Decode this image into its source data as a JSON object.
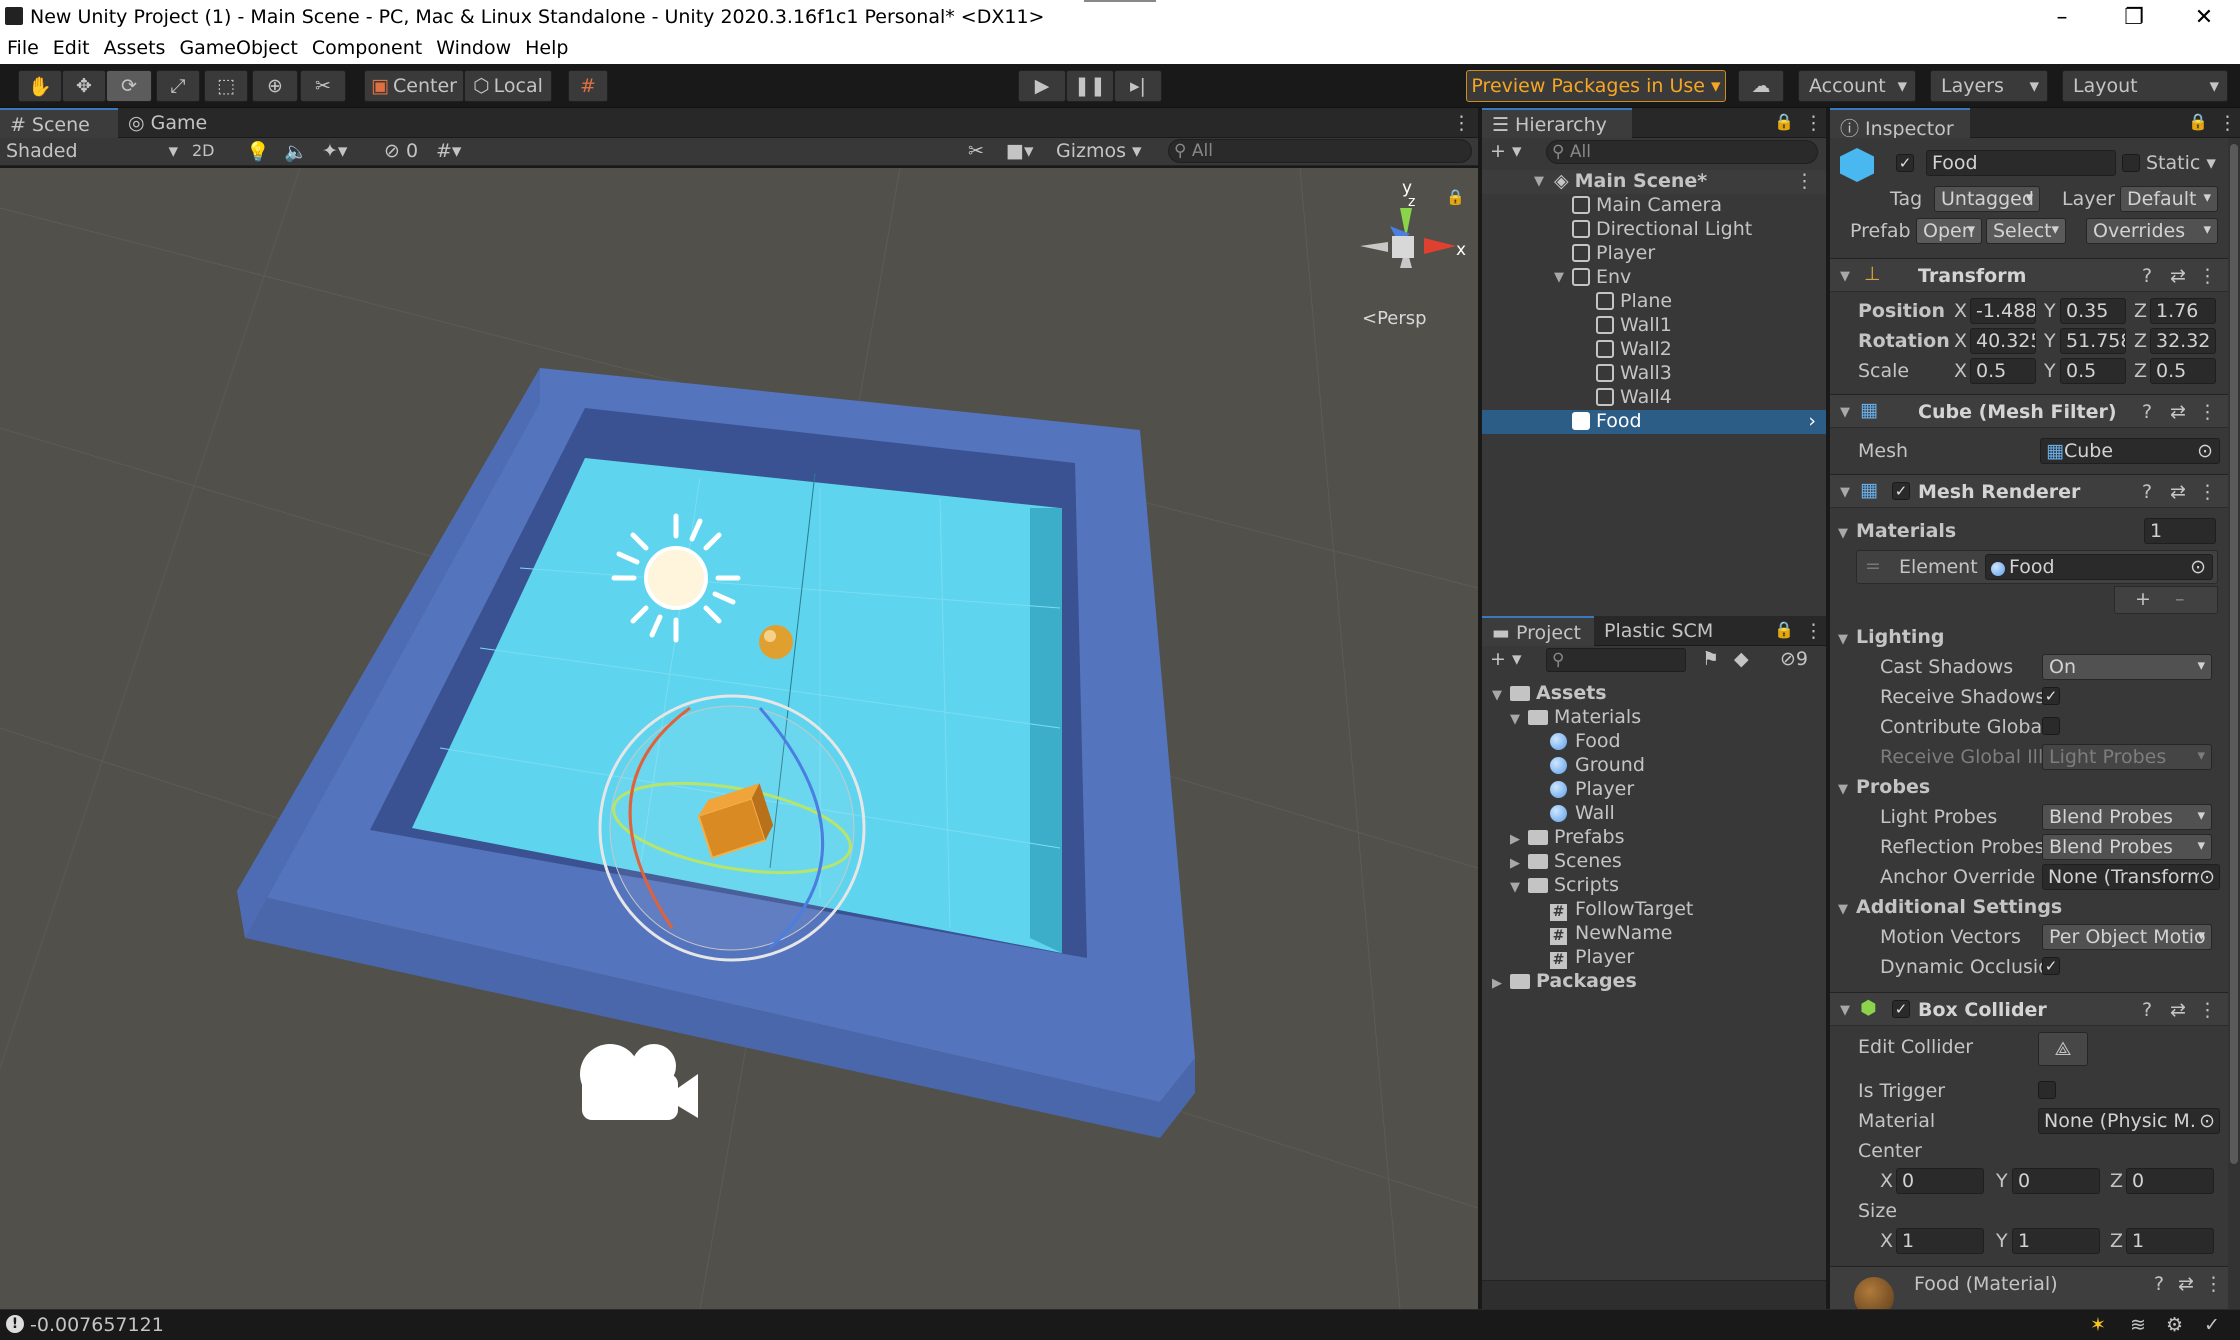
{
  "window": {
    "title": "New Unity Project (1) - Main Scene - PC, Mac & Linux Standalone - Unity 2020.3.16f1c1 Personal* <DX11>"
  },
  "menu": [
    "File",
    "Edit",
    "Assets",
    "GameObject",
    "Component",
    "Window",
    "Help"
  ],
  "toolbar": {
    "center_label": "Center",
    "local_label": "Local",
    "preview_packages": "Preview Packages in Use",
    "account": "Account",
    "layers": "Layers",
    "layout": "Layout"
  },
  "scene_view": {
    "tabs": [
      "Scene",
      "Game"
    ],
    "shading": "Shaded",
    "mode_2d": "2D",
    "hidden_count": "0",
    "gizmos": "Gizmos",
    "search_placeholder": "All",
    "persp_label": "Persp",
    "gizmo_axis_y": "y",
    "gizmo_axis_z": "z",
    "gizmo_axis_x": "x"
  },
  "hierarchy": {
    "title": "Hierarchy",
    "search_placeholder": "All",
    "scene": "Main Scene*",
    "items": [
      "Main Camera",
      "Directional Light",
      "Player",
      "Env",
      "Plane",
      "Wall1",
      "Wall2",
      "Wall3",
      "Wall4",
      "Food"
    ],
    "selected": "Food"
  },
  "project": {
    "tabs": [
      "Project",
      "Plastic SCM"
    ],
    "hidden_count": "9",
    "tree": {
      "assets": "Assets",
      "materials": "Materials",
      "mat_items": [
        "Food",
        "Ground",
        "Player",
        "Wall"
      ],
      "prefabs": "Prefabs",
      "scenes": "Scenes",
      "scripts": "Scripts",
      "script_items": [
        "FollowTarget",
        "NewName",
        "Player"
      ],
      "packages": "Packages"
    }
  },
  "inspector": {
    "title": "Inspector",
    "object_name": "Food",
    "static_label": "Static",
    "tag_label": "Tag",
    "tag_value": "Untagged",
    "layer_label": "Layer",
    "layer_value": "Default",
    "prefab_label": "Prefab",
    "open": "Open",
    "select": "Select",
    "overrides": "Overrides",
    "transform": {
      "title": "Transform",
      "position_label": "Position",
      "rotation_label": "Rotation",
      "scale_label": "Scale",
      "position": {
        "x": "-1.488",
        "y": "0.35",
        "z": "1.76"
      },
      "rotation": {
        "x": "40.325",
        "y": "51.758",
        "z": "32.32"
      },
      "scale": {
        "x": "0.5",
        "y": "0.5",
        "z": "0.5"
      }
    },
    "mesh_filter": {
      "title": "Cube (Mesh Filter)",
      "mesh_label": "Mesh",
      "mesh_value": "Cube"
    },
    "mesh_renderer": {
      "title": "Mesh Renderer",
      "materials_label": "Materials",
      "materials_count": "1",
      "element_label": "Element",
      "element_value": "Food",
      "lighting_label": "Lighting",
      "cast_shadows_label": "Cast Shadows",
      "cast_shadows_value": "On",
      "receive_shadows_label": "Receive Shadows",
      "contribute_gi_label": "Contribute Global",
      "receive_gi_label": "Receive Global Ill",
      "receive_gi_value": "Light Probes",
      "probes_label": "Probes",
      "light_probes_label": "Light Probes",
      "light_probes_value": "Blend Probes",
      "reflection_probes_label": "Reflection Probes",
      "reflection_probes_value": "Blend Probes",
      "anchor_override_label": "Anchor Override",
      "anchor_override_value": "None (Transform",
      "additional_label": "Additional Settings",
      "motion_vectors_label": "Motion Vectors",
      "motion_vectors_value": "Per Object Motio",
      "dynamic_occlusion_label": "Dynamic Occlusio"
    },
    "box_collider": {
      "title": "Box Collider",
      "edit_collider_label": "Edit Collider",
      "is_trigger_label": "Is Trigger",
      "material_label": "Material",
      "material_value": "None (Physic M.",
      "center_label": "Center",
      "center": {
        "x": "0",
        "y": "0",
        "z": "0"
      },
      "size_label": "Size",
      "size": {
        "x": "1",
        "y": "1",
        "z": "1"
      }
    },
    "material_preview": "Food (Material)"
  },
  "status": {
    "message": "-0.007657121"
  }
}
